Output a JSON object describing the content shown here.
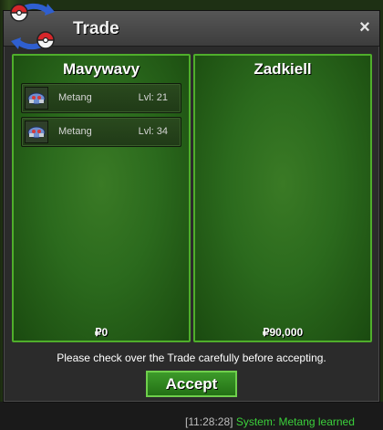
{
  "window": {
    "title": "Trade",
    "close_label": "×"
  },
  "left_panel": {
    "name": "Mavywavy",
    "items": [
      {
        "pokemon": "Metang",
        "level": "Lvl: 21",
        "icon": "metang-icon"
      },
      {
        "pokemon": "Metang",
        "level": "Lvl: 34",
        "icon": "metang-icon"
      }
    ],
    "money": "₽0"
  },
  "right_panel": {
    "name": "Zadkiell",
    "items": [],
    "money": "₽90,000"
  },
  "notice": "Please check over the Trade carefully before accepting.",
  "accept_label": "Accept",
  "chat": {
    "time": "[11:28:28]",
    "message": " System: Metang learned"
  },
  "colors": {
    "panel_border": "#4fae2b",
    "panel_fill": "#2b6a1d",
    "accept_button": "#2e8a1f"
  }
}
